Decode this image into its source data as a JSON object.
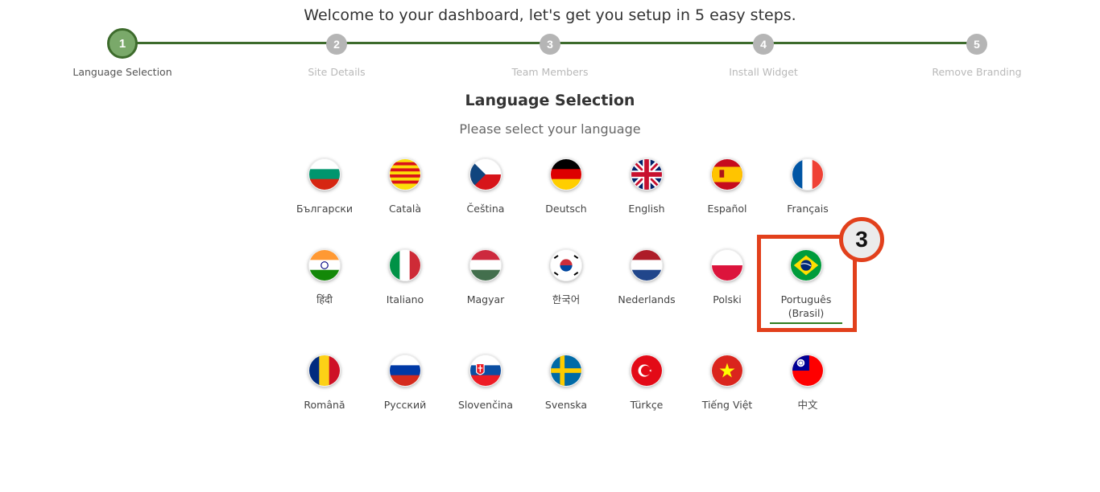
{
  "header": {
    "welcome": "Welcome to your dashboard, let's get you setup in 5 easy steps."
  },
  "steps": [
    {
      "number": "1",
      "label": "Language Selection",
      "state": "active"
    },
    {
      "number": "2",
      "label": "Site Details",
      "state": "inactive"
    },
    {
      "number": "3",
      "label": "Team Members",
      "state": "inactive"
    },
    {
      "number": "4",
      "label": "Install Widget",
      "state": "inactive"
    },
    {
      "number": "5",
      "label": "Remove Branding",
      "state": "inactive"
    }
  ],
  "section": {
    "title": "Language Selection",
    "subtitle": "Please select your language"
  },
  "languages": [
    {
      "label": "Български",
      "flag": "bulgaria-flag-icon"
    },
    {
      "label": "Català",
      "flag": "catalonia-flag-icon"
    },
    {
      "label": "Čeština",
      "flag": "czech-flag-icon"
    },
    {
      "label": "Deutsch",
      "flag": "germany-flag-icon"
    },
    {
      "label": "English",
      "flag": "uk-flag-icon"
    },
    {
      "label": "Español",
      "flag": "spain-flag-icon"
    },
    {
      "label": "Français",
      "flag": "france-flag-icon"
    },
    {
      "label": "हिंदी",
      "flag": "india-flag-icon"
    },
    {
      "label": "Italiano",
      "flag": "italy-flag-icon"
    },
    {
      "label": "Magyar",
      "flag": "hungary-flag-icon"
    },
    {
      "label": "한국어",
      "flag": "korea-flag-icon"
    },
    {
      "label": "Nederlands",
      "flag": "netherlands-flag-icon"
    },
    {
      "label": "Polski",
      "flag": "poland-flag-icon"
    },
    {
      "label": "Português (Brasil)",
      "flag": "brazil-flag-icon",
      "selected": true
    },
    {
      "label": "Română",
      "flag": "romania-flag-icon"
    },
    {
      "label": "Русский",
      "flag": "russia-flag-icon"
    },
    {
      "label": "Slovenčina",
      "flag": "slovakia-flag-icon"
    },
    {
      "label": "Svenska",
      "flag": "sweden-flag-icon"
    },
    {
      "label": "Türkçe",
      "flag": "turkey-flag-icon"
    },
    {
      "label": "Tiếng Việt",
      "flag": "vietnam-flag-icon"
    },
    {
      "label": "中文",
      "flag": "taiwan-flag-icon"
    }
  ],
  "annotation": {
    "badge": "3"
  },
  "colors": {
    "accent": "#3d6b2c",
    "highlight": "#e2401c",
    "step_inactive": "#b5b5b5"
  }
}
